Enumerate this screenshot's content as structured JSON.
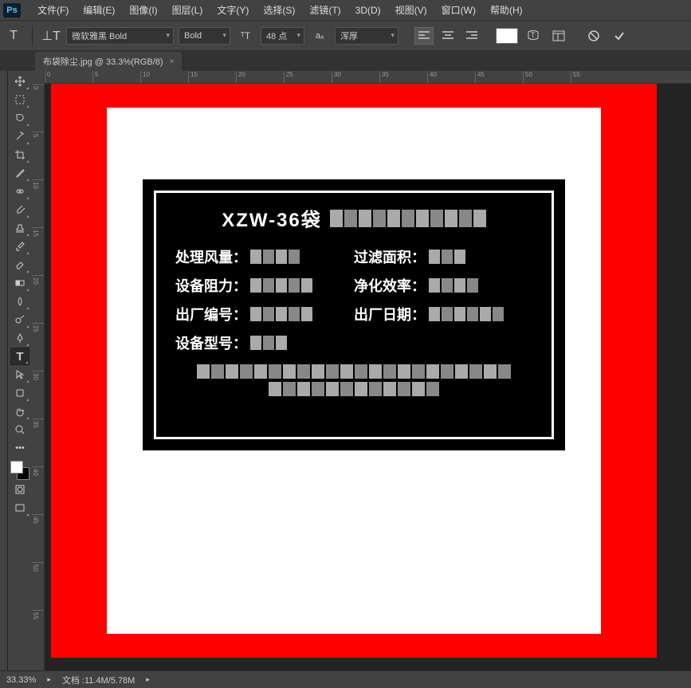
{
  "logo": "Ps",
  "menu": [
    "文件(F)",
    "编辑(E)",
    "图像(I)",
    "图层(L)",
    "文字(Y)",
    "选择(S)",
    "滤镜(T)",
    "3D(D)",
    "视图(V)",
    "窗口(W)",
    "帮助(H)"
  ],
  "opt": {
    "font": "微软雅黑 Bold",
    "weight": "Bold",
    "size": "48 点",
    "aa": "浑厚"
  },
  "tab": {
    "name": "布袋除尘.jpg @ 33.3%(RGB/8)",
    "close": "×"
  },
  "ruler_h": [
    "0",
    "5",
    "10",
    "15",
    "20",
    "25",
    "30",
    "35",
    "40",
    "45",
    "50",
    "55"
  ],
  "ruler_v": [
    "0",
    "5",
    "10",
    "15",
    "20",
    "25",
    "30",
    "35",
    "40",
    "45",
    "50",
    "55"
  ],
  "plate": {
    "title_prefix": "XZW-36袋",
    "r1a": "处理风量：",
    "r1b": "过滤面积：",
    "r2a": "设备阻力：",
    "r2b": "净化效率：",
    "r3a": "出厂编号：",
    "r3b": "出厂日期：",
    "r4a": "设备型号："
  },
  "status": {
    "zoom": "33.33%",
    "doc": "文档 :11.4M/5.78M"
  }
}
